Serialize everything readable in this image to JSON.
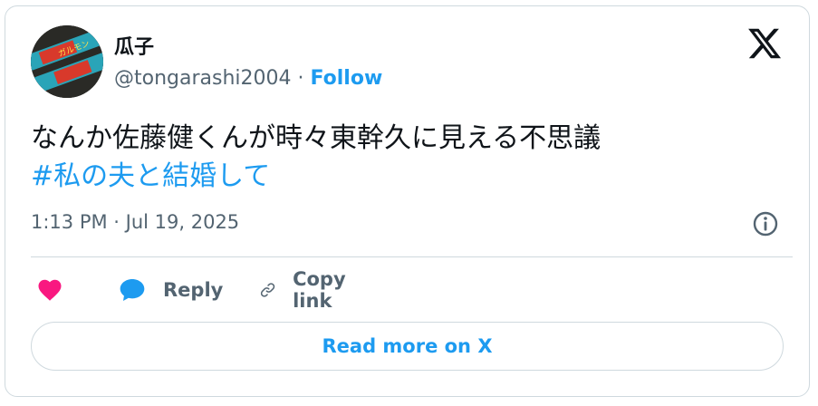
{
  "author": {
    "display_name": "瓜子",
    "handle": "@tongarashi2004",
    "separator": "·",
    "follow_label": "Follow",
    "avatar_text": "ガルモン"
  },
  "tweet": {
    "text": "なんか佐藤健くんが時々東幹久に見える不思議",
    "hashtag": "#私の夫と結婚して",
    "timestamp": "1:13 PM · Jul 19, 2025"
  },
  "actions": {
    "reply_label": "Reply",
    "copy_link_label": "Copy link"
  },
  "read_more_label": "Read more on X",
  "icons": {
    "like": "heart-icon",
    "reply": "speech-bubble-icon",
    "copy": "link-icon",
    "info": "info-icon",
    "brand": "x-logo-icon"
  },
  "colors": {
    "accent": "#1d9bf0",
    "heart": "#f91880",
    "muted": "#536471",
    "border": "#cfd9de"
  }
}
